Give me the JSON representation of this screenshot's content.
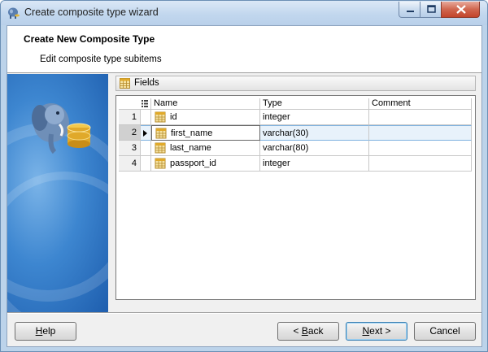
{
  "window": {
    "title": "Create composite type wizard"
  },
  "header": {
    "title": "Create New Composite Type",
    "subtitle": "Edit composite type subitems"
  },
  "fields_panel": {
    "label": "Fields"
  },
  "grid": {
    "columns": [
      "Name",
      "Type",
      "Comment"
    ],
    "rows": [
      {
        "num": "1",
        "name": "id",
        "type": "integer",
        "comment": ""
      },
      {
        "num": "2",
        "name": "first_name",
        "type": "varchar(30)",
        "comment": ""
      },
      {
        "num": "3",
        "name": "last_name",
        "type": "varchar(80)",
        "comment": ""
      },
      {
        "num": "4",
        "name": "passport_id",
        "type": "integer",
        "comment": ""
      }
    ],
    "selected_row": 2
  },
  "buttons": {
    "help": {
      "pre": "",
      "key": "H",
      "post": "elp"
    },
    "back": {
      "pre": "< ",
      "key": "B",
      "post": "ack"
    },
    "next": {
      "pre": "",
      "key": "N",
      "post": "ext >"
    },
    "cancel": {
      "pre": "",
      "key": "",
      "post": "Cancel"
    }
  },
  "icons": {
    "app": "elephant-db-icon",
    "fields": "table-icon",
    "field_row": "field-icon"
  },
  "colors": {
    "window_border": "#6b8fb5",
    "selection": "#e8f2fb",
    "side_panel": "#3d86d0"
  }
}
